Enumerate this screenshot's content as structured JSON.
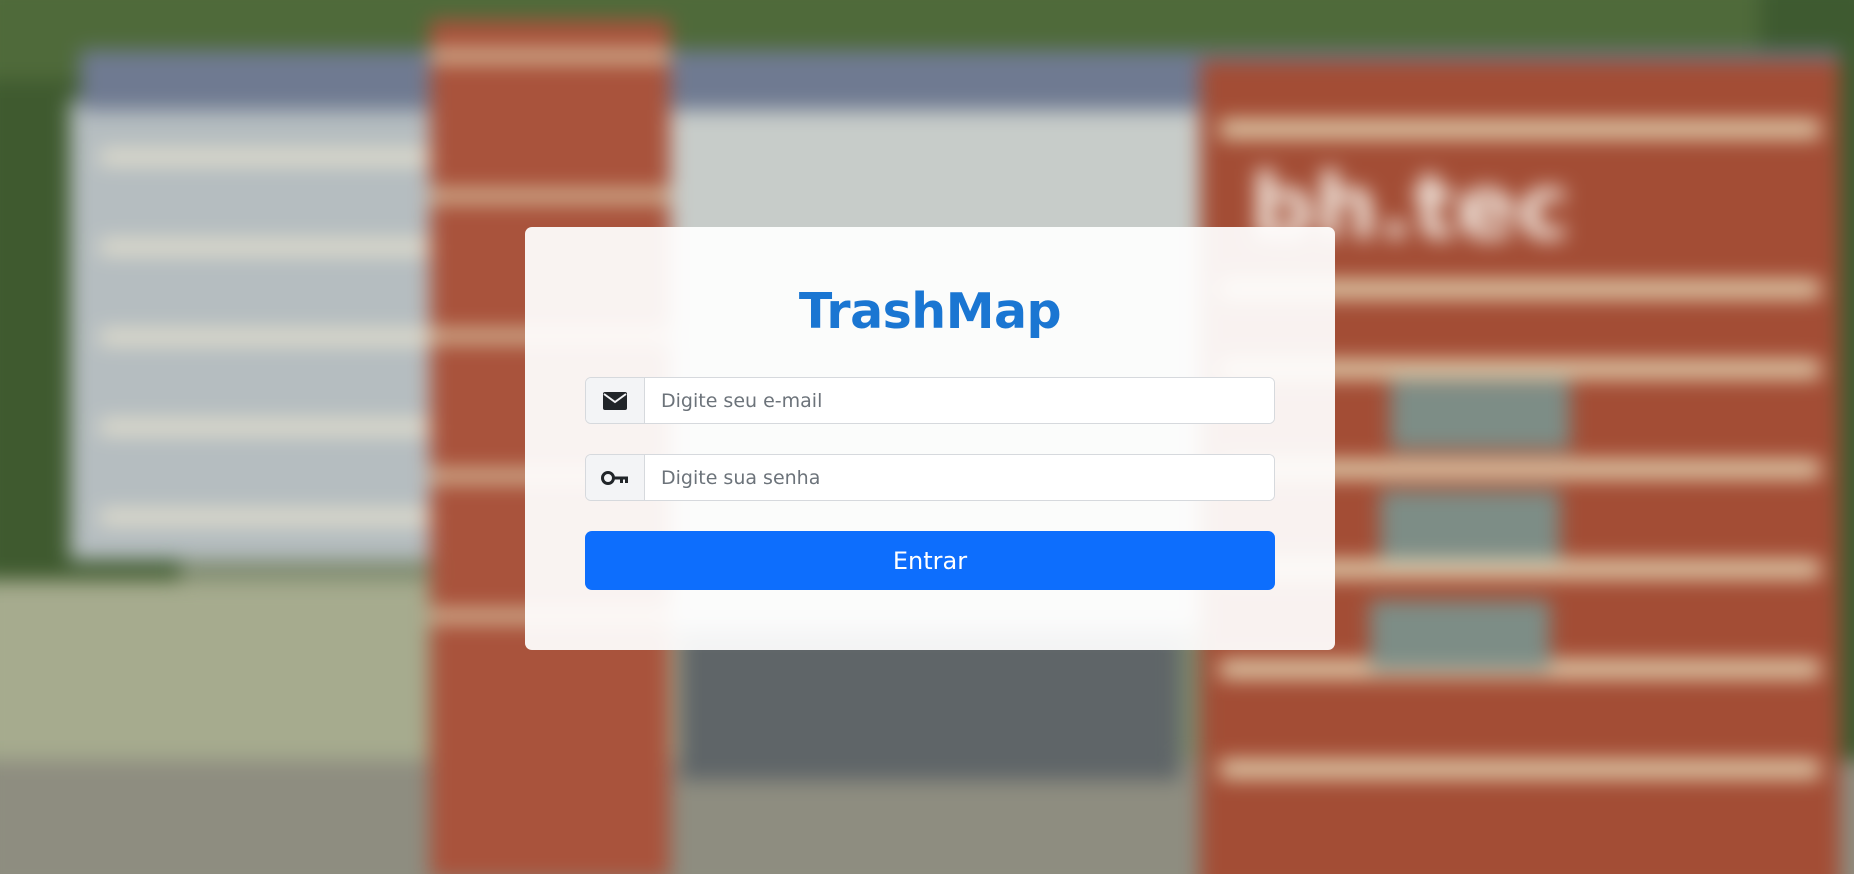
{
  "app": {
    "title": "TrashMap"
  },
  "background": {
    "sign_text": "bh.tec"
  },
  "form": {
    "email": {
      "icon": "envelope-icon",
      "placeholder": "Digite seu e-mail",
      "value": ""
    },
    "password": {
      "icon": "key-icon",
      "placeholder": "Digite sua senha",
      "value": ""
    },
    "submit_label": "Entrar"
  },
  "colors": {
    "title": "#1a76d2",
    "primary_button": "#0d6efd",
    "card_background": "#ffffff"
  }
}
